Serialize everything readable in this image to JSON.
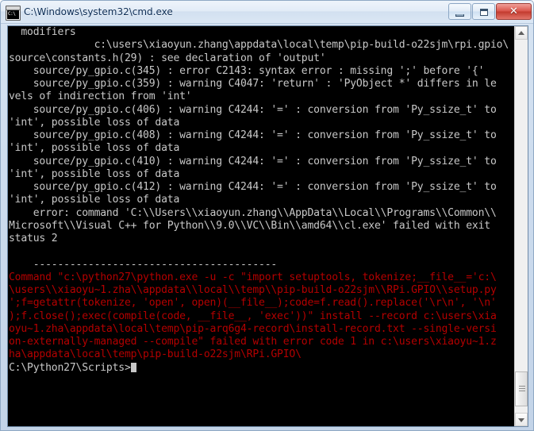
{
  "window": {
    "title": "C:\\Windows\\system32\\cmd.exe",
    "icon_text": "C:\\",
    "icon_name": "cmd-console-icon",
    "buttons": {
      "minimize_label": "–",
      "maximize_label": "□",
      "close_label": "✕"
    },
    "colors": {
      "console_bg": "#000000",
      "console_fg": "#c8c8c8",
      "error_fg": "#b40000",
      "titlebar_text": "#0b2c54",
      "close_button": "#c33a2e"
    }
  },
  "console": {
    "normal_output": "  modifiers\n              c:\\users\\xiaoyun.zhang\\appdata\\local\\temp\\pip-build-o22sjm\\rpi.gpio\\\nsource\\constants.h(29) : see declaration of 'output'\n    source/py_gpio.c(345) : error C2143: syntax error : missing ';' before '{'\n    source/py_gpio.c(359) : warning C4047: 'return' : 'PyObject *' differs in le\nvels of indirection from 'int'\n    source/py_gpio.c(406) : warning C4244: '=' : conversion from 'Py_ssize_t' to\n'int', possible loss of data\n    source/py_gpio.c(408) : warning C4244: '=' : conversion from 'Py_ssize_t' to\n'int', possible loss of data\n    source/py_gpio.c(410) : warning C4244: '=' : conversion from 'Py_ssize_t' to\n'int', possible loss of data\n    source/py_gpio.c(412) : warning C4244: '=' : conversion from 'Py_ssize_t' to\n'int', possible loss of data\n    error: command 'C:\\\\Users\\\\xiaoyun.zhang\\\\AppData\\\\Local\\\\Programs\\\\Common\\\\\nMicrosoft\\\\Visual C++ for Python\\\\9.0\\\\VC\\\\Bin\\\\amd64\\\\cl.exe' failed with exit\nstatus 2\n\n    ----------------------------------------",
    "error_output": "Command \"c:\\python27\\python.exe -u -c \"import setuptools, tokenize;__file__='c:\\\n\\users\\\\xiaoyu~1.zha\\\\appdata\\\\local\\\\temp\\\\pip-build-o22sjm\\\\RPi.GPIO\\\\setup.py\n';f=getattr(tokenize, 'open', open)(__file__);code=f.read().replace('\\r\\n', '\\n'\n);f.close();exec(compile(code, __file__, 'exec'))\" install --record c:\\users\\xia\noyu~1.zha\\appdata\\local\\temp\\pip-arq6g4-record\\install-record.txt --single-versi\non-externally-managed --compile\" failed with error code 1 in c:\\users\\xiaoyu~1.z\nha\\appdata\\local\\temp\\pip-build-o22sjm\\RPi.GPIO\\",
    "prompt": "C:\\Python27\\Scripts>"
  },
  "scrollbar": {
    "up_arrow": "scroll-up",
    "down_arrow": "scroll-down",
    "position": "bottom"
  }
}
